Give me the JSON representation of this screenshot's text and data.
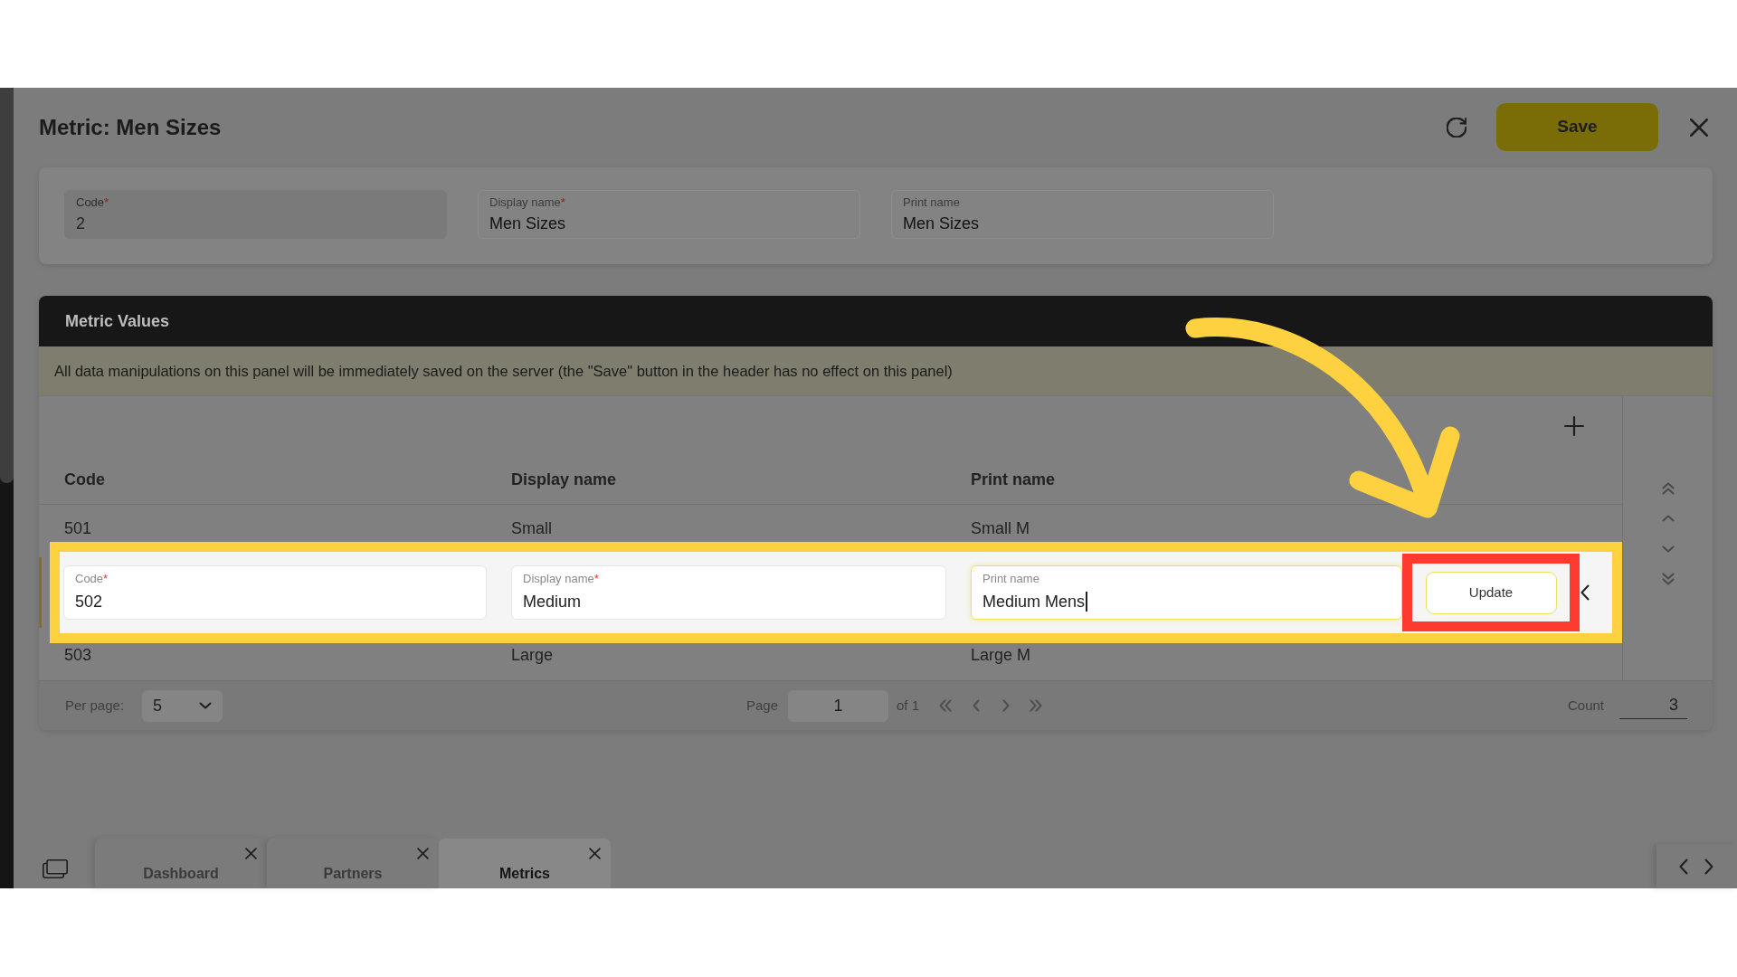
{
  "header": {
    "title": "Metric: Men Sizes",
    "save_button": "Save"
  },
  "form": {
    "fields": [
      {
        "label": "Code",
        "required_mark": "*",
        "value": "2",
        "disabled": true
      },
      {
        "label": "Display name",
        "required_mark": "*",
        "value": "Men Sizes",
        "disabled": false
      },
      {
        "label": "Print name",
        "value": "Men Sizes",
        "disabled": false
      }
    ]
  },
  "metric_values": {
    "title": "Metric Values",
    "notice": "All data manipulations on this panel will be immediately saved on the server (the \"Save\" button in the header has no effect on this panel)",
    "columns": [
      "Code",
      "Display name",
      "Print name"
    ],
    "rows": [
      {
        "kind": "view",
        "cells": [
          "501",
          "Small",
          "Small M"
        ]
      },
      {
        "kind": "edit",
        "fields": [
          {
            "label": "Code",
            "required_mark": "*",
            "value": "502",
            "focused": false
          },
          {
            "label": "Display name",
            "required_mark": "*",
            "value": "Medium",
            "focused": false
          },
          {
            "label": "Print name",
            "value": "Medium Mens",
            "focused": true
          }
        ],
        "update_button": "Update"
      },
      {
        "kind": "view",
        "cells": [
          "503",
          "Large",
          "Large M"
        ]
      }
    ],
    "pagination": {
      "per_page_label": "Per page:",
      "per_page": "5",
      "page_label": "Page",
      "page": "1",
      "page_total": "of 1",
      "count_label": "Count",
      "count": "3"
    }
  },
  "tabs": [
    {
      "label": "Dashboard",
      "selected": false
    },
    {
      "label": "Partners",
      "selected": false
    },
    {
      "label": "Metrics",
      "selected": true
    }
  ]
}
